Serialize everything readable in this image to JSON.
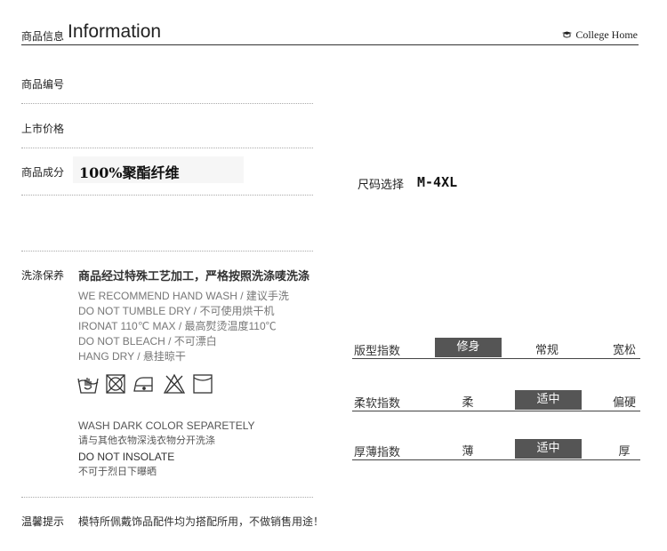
{
  "header": {
    "title_cn": "商品信息",
    "title_en": "Information",
    "brand": "College Home"
  },
  "specs": {
    "code_label": "商品编号",
    "price_label": "上市价格",
    "composition_label": "商品成分",
    "composition_value": "100%聚酯纤维",
    "size_label": "尺码选择",
    "size_value": "M-4XL"
  },
  "care": {
    "label": "洗涤保养",
    "heading": "商品经过特殊工艺加工，严格按照洗涤唛洗涤",
    "lines": [
      "WE RECOMMEND HAND WASH / 建议手洗",
      "DO NOT TUMBLE DRY /  不可使用烘干机",
      "IRONAT 110℃ MAX /  最高熨烫温度110℃",
      "DO NOT BLEACH /  不可漂白",
      "HANG DRY / 悬挂晾干"
    ],
    "icons": [
      "hand-wash-icon",
      "no-tumble-dry-icon",
      "iron-icon",
      "no-bleach-icon",
      "hang-dry-icon"
    ],
    "wash_dark": "WASH DARK COLOR SEPARETELY",
    "wash_dark_cn": "请与其他衣物深浅衣物分开洗涤",
    "insolate": "DO NOT INSOLATE",
    "insolate_cn": "不可于烈日下曝晒"
  },
  "tips": {
    "label": "温馨提示",
    "text": "模特所佩戴饰品配件均为搭配所用，不做销售用途！"
  },
  "indices": [
    {
      "label": "版型指数",
      "options": [
        "修身",
        "常规",
        "宽松"
      ],
      "selected": 0
    },
    {
      "label": "柔软指数",
      "options": [
        "柔",
        "适中",
        "偏硬"
      ],
      "selected": 1
    },
    {
      "label": "厚薄指数",
      "options": [
        "薄",
        "适中",
        "厚"
      ],
      "selected": 1
    }
  ],
  "colors": {
    "selected_bg": "#555555",
    "text": "#222222",
    "muted": "#777777"
  }
}
